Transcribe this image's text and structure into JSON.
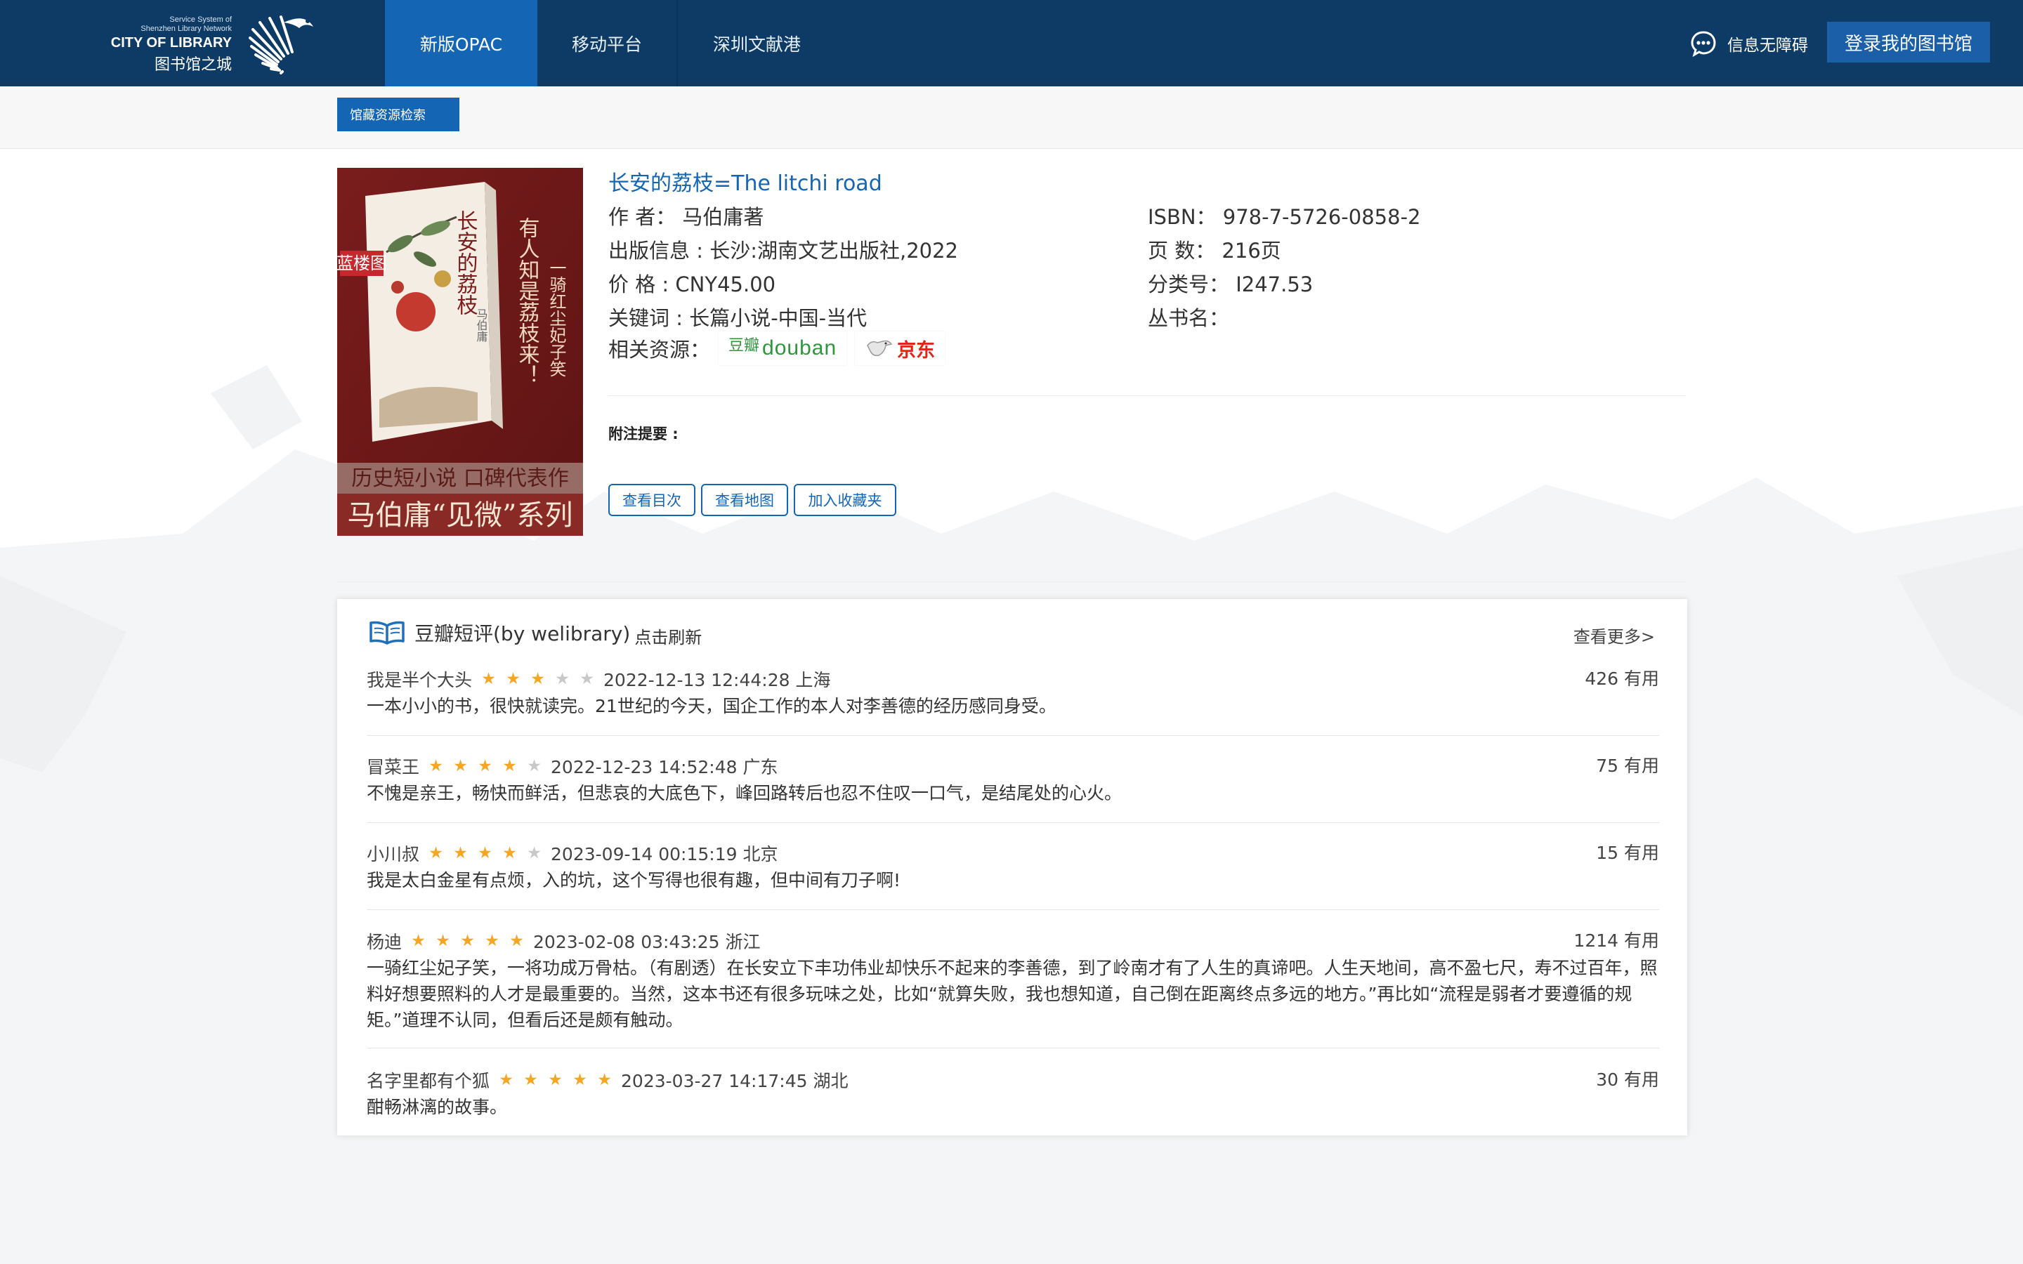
{
  "header": {
    "logo": {
      "line1": "Service System of",
      "line2": "Shenzhen Library Network",
      "line3": "CITY OF LIBRARY",
      "line4": "图书馆之城"
    },
    "nav": [
      {
        "label": "新版OPAC",
        "active": true
      },
      {
        "label": "移动平台",
        "active": false
      },
      {
        "label": "深圳文献港",
        "active": false
      }
    ],
    "accessibility": "信息无障碍",
    "login": "登录我的图书馆"
  },
  "breadcrumb": "馆藏资源检索",
  "cover": {
    "title_vertical": "长安的荔枝",
    "badge": "蓝楼图",
    "tagline_vertical": "有人知是荔枝来！",
    "tagline2_vertical": "一骑红尘妃子笑",
    "author_vertical": "马伯庸",
    "banner1": "历史短小说 口碑代表作",
    "banner2": "马伯庸“见微”系列"
  },
  "book": {
    "title": "长安的荔枝=The litchi road",
    "author": "作 者： 马伯庸著",
    "publish": "出版信息 : 长沙:湖南文艺出版社,2022",
    "price": "价 格 : CNY45.00",
    "keywords": "关键词 : 长篇小说-中国-当代",
    "isbn": "ISBN： 978-7-5726-0858-2",
    "pages": "页 数： 216页",
    "classno": "分类号： I247.53",
    "series": "丛书名：",
    "related_label": "相关资源：",
    "douban_cn": "豆瓣",
    "douban_en": "douban",
    "jd": "京东",
    "notes": "附注提要 :",
    "buttons": [
      "查看目次",
      "查看地图",
      "加入收藏夹"
    ]
  },
  "reviews": {
    "title": "豆瓣短评(by welibrary)",
    "refresh": "点击刷新",
    "more": "查看更多>",
    "items": [
      {
        "user": "我是半个大头",
        "stars": 3,
        "time": "2022-12-13 12:44:28 上海",
        "useful": "426 有用",
        "content": "一本小小的书，很快就读完。21世纪的今天，国企工作的本人对李善德的经历感同身受。"
      },
      {
        "user": "冒菜王",
        "stars": 4,
        "time": "2022-12-23 14:52:48 广东",
        "useful": "75 有用",
        "content": "不愧是亲王，畅快而鲜活，但悲哀的大底色下，峰回路转后也忍不住叹一口气，是结尾处的心火。"
      },
      {
        "user": "小川叔",
        "stars": 4,
        "time": "2023-09-14 00:15:19 北京",
        "useful": "15 有用",
        "content": "我是太白金星有点烦，入的坑，这个写得也很有趣，但中间有刀子啊!"
      },
      {
        "user": "杨迪",
        "stars": 5,
        "time": "2023-02-08 03:43:25 浙江",
        "useful": "1214 有用",
        "content": "一骑红尘妃子笑，一将功成万骨枯。（有剧透）在长安立下丰功伟业却快乐不起来的李善德，到了岭南才有了人生的真谛吧。人生天地间，高不盈七尺，寿不过百年，照料好想要照料的人才是最重要的。当然，这本书还有很多玩味之处，比如“就算失败，我也想知道，自己倒在距离终点多远的地方。”再比如“流程是弱者才要遵循的规矩。”道理不认同，但看后还是颇有触动。"
      },
      {
        "user": "名字里都有个狐",
        "stars": 5,
        "time": "2023-03-27 14:17:45 湖北",
        "useful": "30 有用",
        "content": "酣畅淋漓的故事。"
      }
    ]
  },
  "colors": {
    "header_bg": "#0d3b66",
    "accent": "#1565b5",
    "star_on": "#f5a623",
    "star_off": "#c8c8c8"
  }
}
